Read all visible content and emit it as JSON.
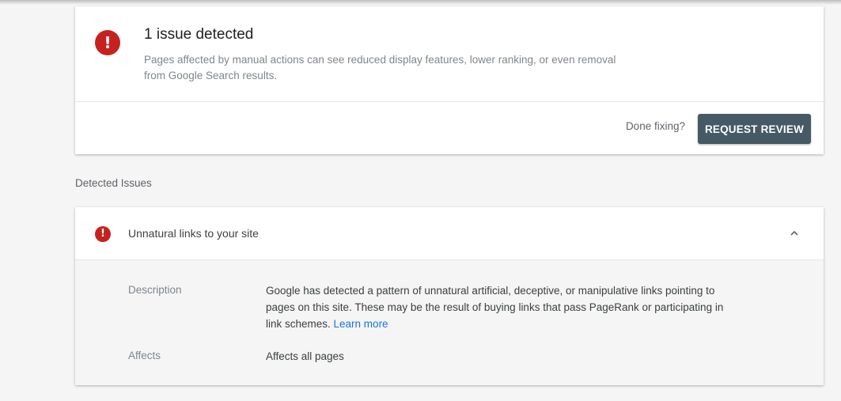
{
  "summary": {
    "title": "1 issue detected",
    "description": "Pages affected by manual actions can see reduced display features, lower ranking, or even removal from Google Search results.",
    "done_fixing": "Done fixing?",
    "request_review_label": "REQUEST REVIEW"
  },
  "detected_issues": {
    "section_label": "Detected Issues",
    "items": [
      {
        "title": "Unnatural links to your site",
        "description_label": "Description",
        "description_text": "Google has detected a pattern of unnatural artificial, deceptive, or manipulative links pointing to pages on this site. These may be the result of buying links that pass PageRank or participating in link schemes. ",
        "learn_more": "Learn more",
        "affects_label": "Affects",
        "affects_value": "Affects all pages"
      }
    ]
  },
  "icons": {
    "error": "error-icon",
    "collapse": "chevron-up-icon"
  },
  "colors": {
    "error_red": "#c5221f",
    "button_bg": "#455a64",
    "link_blue": "#1a73e8"
  }
}
